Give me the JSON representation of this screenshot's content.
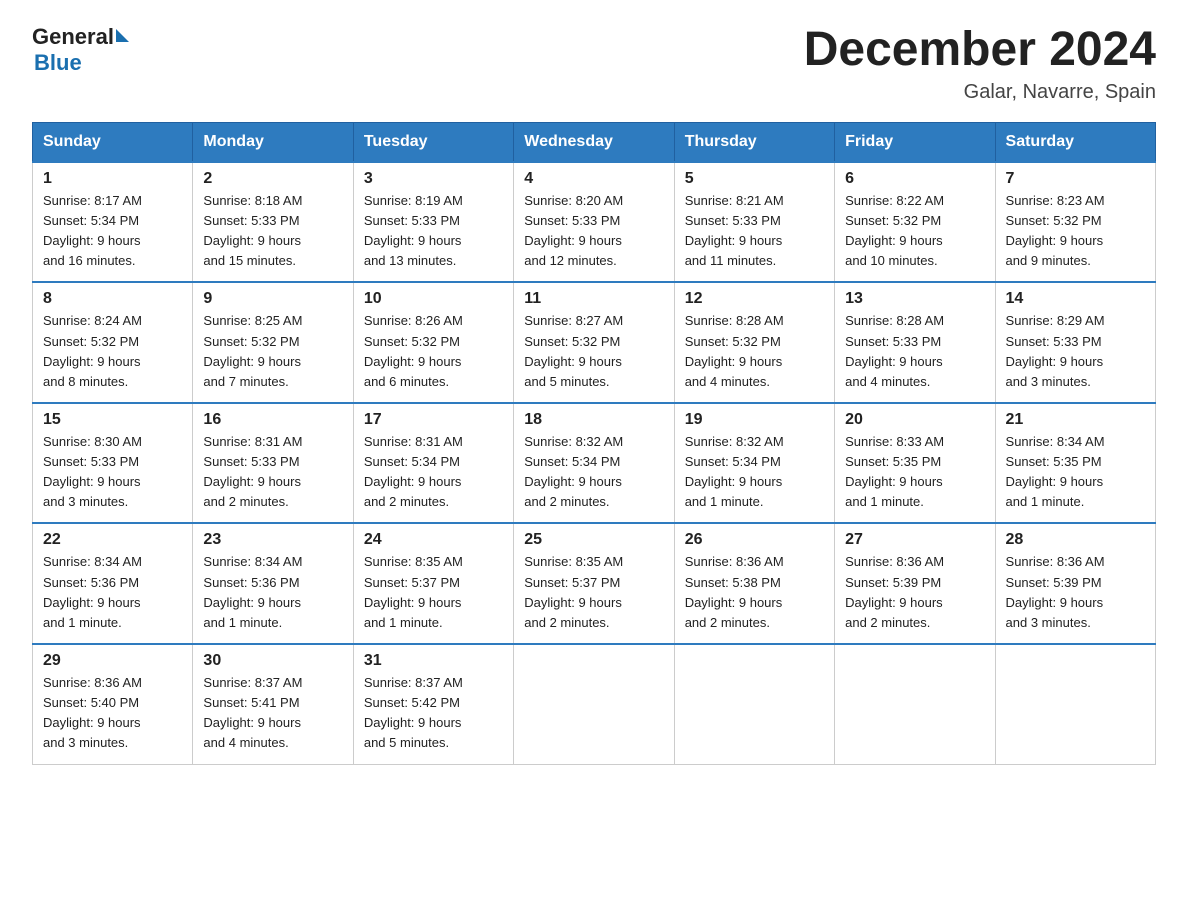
{
  "header": {
    "logo_general": "General",
    "logo_blue": "Blue",
    "month_title": "December 2024",
    "location": "Galar, Navarre, Spain"
  },
  "days_of_week": [
    "Sunday",
    "Monday",
    "Tuesday",
    "Wednesday",
    "Thursday",
    "Friday",
    "Saturday"
  ],
  "weeks": [
    [
      {
        "day": "1",
        "sunrise": "8:17 AM",
        "sunset": "5:34 PM",
        "daylight": "9 hours and 16 minutes."
      },
      {
        "day": "2",
        "sunrise": "8:18 AM",
        "sunset": "5:33 PM",
        "daylight": "9 hours and 15 minutes."
      },
      {
        "day": "3",
        "sunrise": "8:19 AM",
        "sunset": "5:33 PM",
        "daylight": "9 hours and 13 minutes."
      },
      {
        "day": "4",
        "sunrise": "8:20 AM",
        "sunset": "5:33 PM",
        "daylight": "9 hours and 12 minutes."
      },
      {
        "day": "5",
        "sunrise": "8:21 AM",
        "sunset": "5:33 PM",
        "daylight": "9 hours and 11 minutes."
      },
      {
        "day": "6",
        "sunrise": "8:22 AM",
        "sunset": "5:32 PM",
        "daylight": "9 hours and 10 minutes."
      },
      {
        "day": "7",
        "sunrise": "8:23 AM",
        "sunset": "5:32 PM",
        "daylight": "9 hours and 9 minutes."
      }
    ],
    [
      {
        "day": "8",
        "sunrise": "8:24 AM",
        "sunset": "5:32 PM",
        "daylight": "9 hours and 8 minutes."
      },
      {
        "day": "9",
        "sunrise": "8:25 AM",
        "sunset": "5:32 PM",
        "daylight": "9 hours and 7 minutes."
      },
      {
        "day": "10",
        "sunrise": "8:26 AM",
        "sunset": "5:32 PM",
        "daylight": "9 hours and 6 minutes."
      },
      {
        "day": "11",
        "sunrise": "8:27 AM",
        "sunset": "5:32 PM",
        "daylight": "9 hours and 5 minutes."
      },
      {
        "day": "12",
        "sunrise": "8:28 AM",
        "sunset": "5:32 PM",
        "daylight": "9 hours and 4 minutes."
      },
      {
        "day": "13",
        "sunrise": "8:28 AM",
        "sunset": "5:33 PM",
        "daylight": "9 hours and 4 minutes."
      },
      {
        "day": "14",
        "sunrise": "8:29 AM",
        "sunset": "5:33 PM",
        "daylight": "9 hours and 3 minutes."
      }
    ],
    [
      {
        "day": "15",
        "sunrise": "8:30 AM",
        "sunset": "5:33 PM",
        "daylight": "9 hours and 3 minutes."
      },
      {
        "day": "16",
        "sunrise": "8:31 AM",
        "sunset": "5:33 PM",
        "daylight": "9 hours and 2 minutes."
      },
      {
        "day": "17",
        "sunrise": "8:31 AM",
        "sunset": "5:34 PM",
        "daylight": "9 hours and 2 minutes."
      },
      {
        "day": "18",
        "sunrise": "8:32 AM",
        "sunset": "5:34 PM",
        "daylight": "9 hours and 2 minutes."
      },
      {
        "day": "19",
        "sunrise": "8:32 AM",
        "sunset": "5:34 PM",
        "daylight": "9 hours and 1 minute."
      },
      {
        "day": "20",
        "sunrise": "8:33 AM",
        "sunset": "5:35 PM",
        "daylight": "9 hours and 1 minute."
      },
      {
        "day": "21",
        "sunrise": "8:34 AM",
        "sunset": "5:35 PM",
        "daylight": "9 hours and 1 minute."
      }
    ],
    [
      {
        "day": "22",
        "sunrise": "8:34 AM",
        "sunset": "5:36 PM",
        "daylight": "9 hours and 1 minute."
      },
      {
        "day": "23",
        "sunrise": "8:34 AM",
        "sunset": "5:36 PM",
        "daylight": "9 hours and 1 minute."
      },
      {
        "day": "24",
        "sunrise": "8:35 AM",
        "sunset": "5:37 PM",
        "daylight": "9 hours and 1 minute."
      },
      {
        "day": "25",
        "sunrise": "8:35 AM",
        "sunset": "5:37 PM",
        "daylight": "9 hours and 2 minutes."
      },
      {
        "day": "26",
        "sunrise": "8:36 AM",
        "sunset": "5:38 PM",
        "daylight": "9 hours and 2 minutes."
      },
      {
        "day": "27",
        "sunrise": "8:36 AM",
        "sunset": "5:39 PM",
        "daylight": "9 hours and 2 minutes."
      },
      {
        "day": "28",
        "sunrise": "8:36 AM",
        "sunset": "5:39 PM",
        "daylight": "9 hours and 3 minutes."
      }
    ],
    [
      {
        "day": "29",
        "sunrise": "8:36 AM",
        "sunset": "5:40 PM",
        "daylight": "9 hours and 3 minutes."
      },
      {
        "day": "30",
        "sunrise": "8:37 AM",
        "sunset": "5:41 PM",
        "daylight": "9 hours and 4 minutes."
      },
      {
        "day": "31",
        "sunrise": "8:37 AM",
        "sunset": "5:42 PM",
        "daylight": "9 hours and 5 minutes."
      },
      null,
      null,
      null,
      null
    ]
  ],
  "labels": {
    "sunrise": "Sunrise:",
    "sunset": "Sunset:",
    "daylight": "Daylight:"
  }
}
